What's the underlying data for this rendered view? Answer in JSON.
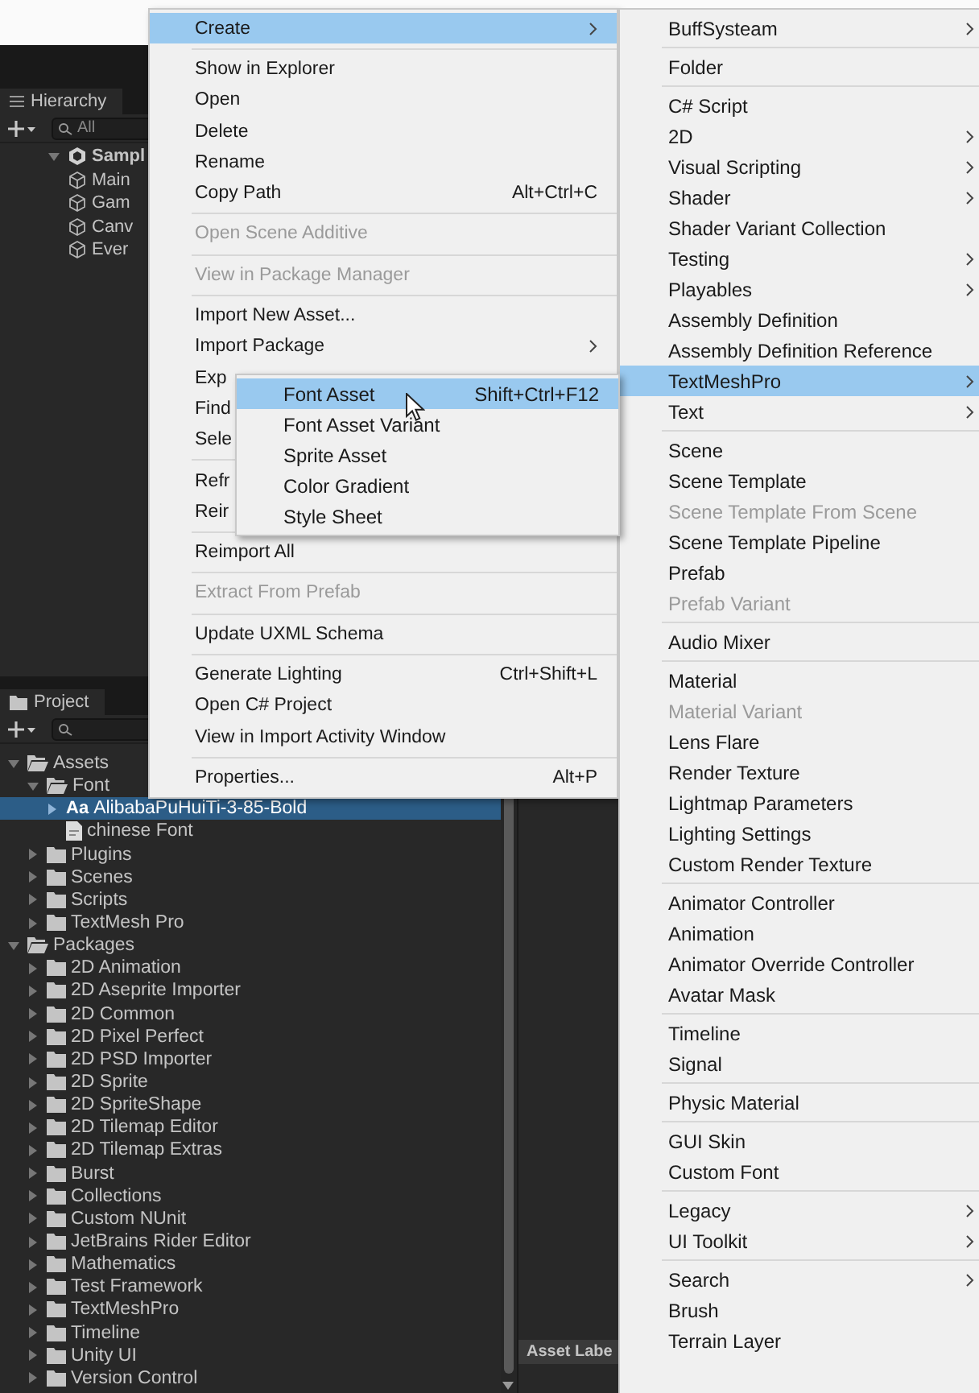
{
  "hierarchy": {
    "tab": "Hierarchy",
    "search": {
      "placeholder": "All"
    },
    "tree": [
      {
        "label": "Sampl",
        "kind": "scene",
        "expanded": true,
        "selected": false,
        "children": [
          {
            "label": "Main",
            "kind": "object",
            "selected": false
          },
          {
            "label": "Gam",
            "kind": "object",
            "selected": false
          },
          {
            "label": "Canv",
            "kind": "object",
            "selected": false
          },
          {
            "label": "Ever",
            "kind": "object",
            "selected": false
          }
        ]
      }
    ]
  },
  "project": {
    "tab": "Project",
    "tree": [
      {
        "label": "Assets",
        "kind": "folder",
        "expanded": true,
        "selected": false,
        "children": [
          {
            "label": "Font",
            "kind": "folder",
            "expanded": true,
            "selected": false,
            "children": [
              {
                "label": "AlibabaPuHuiTi-3-85-Bold",
                "icon_text": "Aa",
                "kind": "font",
                "expanded": false,
                "selected": true
              },
              {
                "label": "chinese Font",
                "kind": "file",
                "selected": false
              }
            ]
          },
          {
            "label": "Plugins",
            "kind": "folder",
            "expanded": false,
            "selected": false
          },
          {
            "label": "Scenes",
            "kind": "folder",
            "expanded": false,
            "selected": false
          },
          {
            "label": "Scripts",
            "kind": "folder",
            "expanded": false,
            "selected": false
          },
          {
            "label": "TextMesh Pro",
            "kind": "folder",
            "expanded": false,
            "selected": false
          }
        ]
      },
      {
        "label": "Packages",
        "kind": "folder",
        "expanded": true,
        "selected": false,
        "children": [
          {
            "label": "2D Animation",
            "kind": "folder",
            "expanded": false,
            "selected": false
          },
          {
            "label": "2D Aseprite Importer",
            "kind": "folder",
            "expanded": false,
            "selected": false
          },
          {
            "label": "2D Common",
            "kind": "folder",
            "expanded": false,
            "selected": false
          },
          {
            "label": "2D Pixel Perfect",
            "kind": "folder",
            "expanded": false,
            "selected": false
          },
          {
            "label": "2D PSD Importer",
            "kind": "folder",
            "expanded": false,
            "selected": false
          },
          {
            "label": "2D Sprite",
            "kind": "folder",
            "expanded": false,
            "selected": false
          },
          {
            "label": "2D SpriteShape",
            "kind": "folder",
            "expanded": false,
            "selected": false
          },
          {
            "label": "2D Tilemap Editor",
            "kind": "folder",
            "expanded": false,
            "selected": false
          },
          {
            "label": "2D Tilemap Extras",
            "kind": "folder",
            "expanded": false,
            "selected": false
          },
          {
            "label": "Burst",
            "kind": "folder",
            "expanded": false,
            "selected": false
          },
          {
            "label": "Collections",
            "kind": "folder",
            "expanded": false,
            "selected": false
          },
          {
            "label": "Custom NUnit",
            "kind": "folder",
            "expanded": false,
            "selected": false
          },
          {
            "label": "JetBrains Rider Editor",
            "kind": "folder",
            "expanded": false,
            "selected": false
          },
          {
            "label": "Mathematics",
            "kind": "folder",
            "expanded": false,
            "selected": false
          },
          {
            "label": "Test Framework",
            "kind": "folder",
            "expanded": false,
            "selected": false
          },
          {
            "label": "TextMeshPro",
            "kind": "folder",
            "expanded": false,
            "selected": false
          },
          {
            "label": "Timeline",
            "kind": "folder",
            "expanded": false,
            "selected": false
          },
          {
            "label": "Unity UI",
            "kind": "folder",
            "expanded": false,
            "selected": false
          },
          {
            "label": "Version Control",
            "kind": "folder",
            "expanded": false,
            "selected": false
          }
        ]
      }
    ],
    "side_panel": {
      "label": "Asset Labe"
    }
  },
  "context_menu": {
    "groups": [
      [
        {
          "label": "Create",
          "selected": true,
          "disabled": false,
          "submenu": true
        }
      ],
      [
        {
          "label": "Show in Explorer",
          "selected": false,
          "disabled": false,
          "submenu": false
        },
        {
          "label": "Open",
          "selected": false,
          "disabled": false,
          "submenu": false
        },
        {
          "label": "Delete",
          "selected": false,
          "disabled": false,
          "submenu": false
        },
        {
          "label": "Rename",
          "selected": false,
          "disabled": false,
          "submenu": false
        },
        {
          "label": "Copy Path",
          "shortcut": "Alt+Ctrl+C",
          "selected": false,
          "disabled": false,
          "submenu": false
        }
      ],
      [
        {
          "label": "Open Scene Additive",
          "selected": false,
          "disabled": true,
          "submenu": false
        }
      ],
      [
        {
          "label": "View in Package Manager",
          "selected": false,
          "disabled": true,
          "submenu": false
        }
      ],
      [
        {
          "label": "Import New Asset...",
          "selected": false,
          "disabled": false,
          "submenu": false
        },
        {
          "label": "Import Package",
          "selected": false,
          "disabled": false,
          "submenu": true
        },
        {
          "label": "Exp",
          "selected": false,
          "disabled": false,
          "submenu": false
        },
        {
          "label": "Find",
          "selected": false,
          "disabled": false,
          "submenu": false
        },
        {
          "label": "Sele",
          "selected": false,
          "disabled": false,
          "submenu": false
        }
      ],
      [
        {
          "label": "Refr",
          "selected": false,
          "disabled": false,
          "submenu": false
        },
        {
          "label": "Reir",
          "selected": false,
          "disabled": false,
          "submenu": false
        }
      ],
      [
        {
          "label": "Reimport All",
          "selected": false,
          "disabled": false,
          "submenu": false
        }
      ],
      [
        {
          "label": "Extract From Prefab",
          "selected": false,
          "disabled": true,
          "submenu": false
        }
      ],
      [
        {
          "label": "Update UXML Schema",
          "selected": false,
          "disabled": false,
          "submenu": false
        }
      ],
      [
        {
          "label": "Generate Lighting",
          "shortcut": "Ctrl+Shift+L",
          "selected": false,
          "disabled": false,
          "submenu": false
        },
        {
          "label": "Open C# Project",
          "selected": false,
          "disabled": false,
          "submenu": false
        },
        {
          "label": "View in Import Activity Window",
          "selected": false,
          "disabled": false,
          "submenu": false
        }
      ],
      [
        {
          "label": "Properties...",
          "shortcut": "Alt+P",
          "selected": false,
          "disabled": false,
          "submenu": false
        }
      ]
    ]
  },
  "create_submenu": {
    "groups": [
      [
        {
          "label": "BuffSysteam",
          "selected": false,
          "disabled": false,
          "submenu": true
        }
      ],
      [
        {
          "label": "Folder",
          "selected": false,
          "disabled": false,
          "submenu": false
        }
      ],
      [
        {
          "label": "C# Script",
          "selected": false,
          "disabled": false,
          "submenu": false
        },
        {
          "label": "2D",
          "selected": false,
          "disabled": false,
          "submenu": true
        },
        {
          "label": "Visual Scripting",
          "selected": false,
          "disabled": false,
          "submenu": true
        },
        {
          "label": "Shader",
          "selected": false,
          "disabled": false,
          "submenu": true
        },
        {
          "label": "Shader Variant Collection",
          "selected": false,
          "disabled": false,
          "submenu": false
        },
        {
          "label": "Testing",
          "selected": false,
          "disabled": false,
          "submenu": true
        },
        {
          "label": "Playables",
          "selected": false,
          "disabled": false,
          "submenu": true
        },
        {
          "label": "Assembly Definition",
          "selected": false,
          "disabled": false,
          "submenu": false
        },
        {
          "label": "Assembly Definition Reference",
          "selected": false,
          "disabled": false,
          "submenu": false
        },
        {
          "label": "TextMeshPro",
          "selected": true,
          "disabled": false,
          "submenu": true
        },
        {
          "label": "Text",
          "selected": false,
          "disabled": false,
          "submenu": true
        }
      ],
      [
        {
          "label": "Scene",
          "selected": false,
          "disabled": false,
          "submenu": false
        },
        {
          "label": "Scene Template",
          "selected": false,
          "disabled": false,
          "submenu": false
        },
        {
          "label": "Scene Template From Scene",
          "selected": false,
          "disabled": true,
          "submenu": false
        },
        {
          "label": "Scene Template Pipeline",
          "selected": false,
          "disabled": false,
          "submenu": false
        },
        {
          "label": "Prefab",
          "selected": false,
          "disabled": false,
          "submenu": false
        },
        {
          "label": "Prefab Variant",
          "selected": false,
          "disabled": true,
          "submenu": false
        }
      ],
      [
        {
          "label": "Audio Mixer",
          "selected": false,
          "disabled": false,
          "submenu": false
        }
      ],
      [
        {
          "label": "Material",
          "selected": false,
          "disabled": false,
          "submenu": false
        },
        {
          "label": "Material Variant",
          "selected": false,
          "disabled": true,
          "submenu": false
        },
        {
          "label": "Lens Flare",
          "selected": false,
          "disabled": false,
          "submenu": false
        },
        {
          "label": "Render Texture",
          "selected": false,
          "disabled": false,
          "submenu": false
        },
        {
          "label": "Lightmap Parameters",
          "selected": false,
          "disabled": false,
          "submenu": false
        },
        {
          "label": "Lighting Settings",
          "selected": false,
          "disabled": false,
          "submenu": false
        },
        {
          "label": "Custom Render Texture",
          "selected": false,
          "disabled": false,
          "submenu": false
        }
      ],
      [
        {
          "label": "Animator Controller",
          "selected": false,
          "disabled": false,
          "submenu": false
        },
        {
          "label": "Animation",
          "selected": false,
          "disabled": false,
          "submenu": false
        },
        {
          "label": "Animator Override Controller",
          "selected": false,
          "disabled": false,
          "submenu": false
        },
        {
          "label": "Avatar Mask",
          "selected": false,
          "disabled": false,
          "submenu": false
        }
      ],
      [
        {
          "label": "Timeline",
          "selected": false,
          "disabled": false,
          "submenu": false
        },
        {
          "label": "Signal",
          "selected": false,
          "disabled": false,
          "submenu": false
        }
      ],
      [
        {
          "label": "Physic Material",
          "selected": false,
          "disabled": false,
          "submenu": false
        }
      ],
      [
        {
          "label": "GUI Skin",
          "selected": false,
          "disabled": false,
          "submenu": false
        },
        {
          "label": "Custom Font",
          "selected": false,
          "disabled": false,
          "submenu": false
        }
      ],
      [
        {
          "label": "Legacy",
          "selected": false,
          "disabled": false,
          "submenu": true
        },
        {
          "label": "UI Toolkit",
          "selected": false,
          "disabled": false,
          "submenu": true
        }
      ],
      [
        {
          "label": "Search",
          "selected": false,
          "disabled": false,
          "submenu": true
        },
        {
          "label": "Brush",
          "selected": false,
          "disabled": false,
          "submenu": false
        },
        {
          "label": "Terrain Layer",
          "selected": false,
          "disabled": false,
          "submenu": false
        }
      ]
    ]
  },
  "textmeshpro_submenu": {
    "groups": [
      [
        {
          "label": "Font Asset",
          "shortcut": "Shift+Ctrl+F12",
          "selected": true,
          "disabled": false,
          "submenu": false
        },
        {
          "label": "Font Asset Variant",
          "selected": false,
          "disabled": false,
          "submenu": false
        },
        {
          "label": "Sprite Asset",
          "selected": false,
          "disabled": false,
          "submenu": false
        },
        {
          "label": "Color Gradient",
          "selected": false,
          "disabled": false,
          "submenu": false
        },
        {
          "label": "Style Sheet",
          "selected": false,
          "disabled": false,
          "submenu": false
        }
      ]
    ]
  }
}
